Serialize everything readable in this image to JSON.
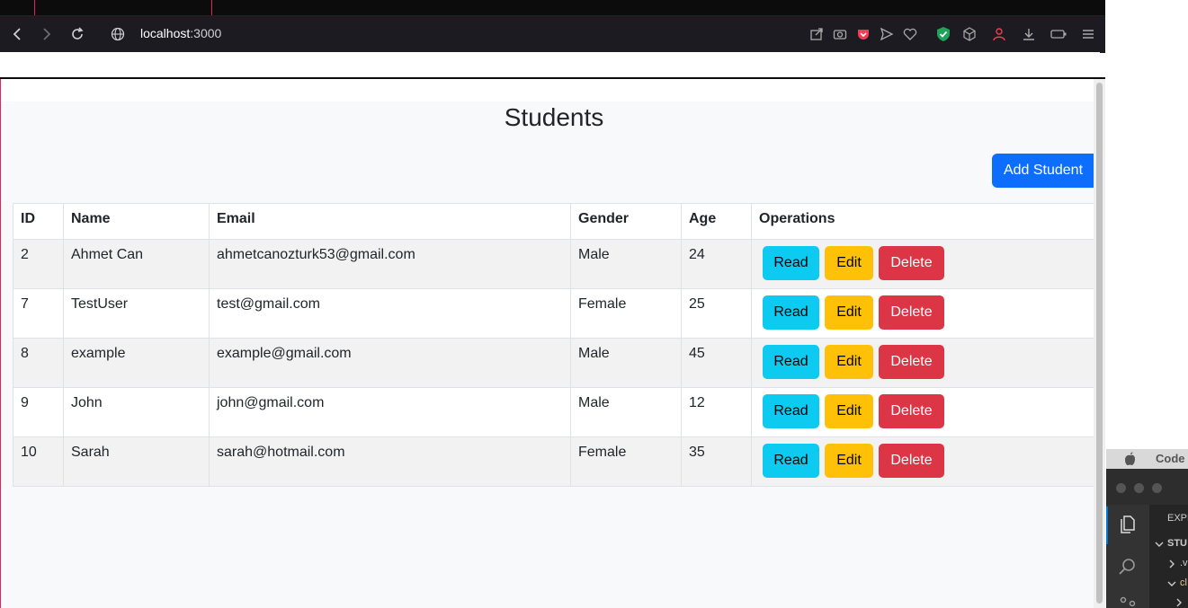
{
  "browser": {
    "url_host": "localhost",
    "url_port": ":3000"
  },
  "page": {
    "title": "Students",
    "add_button": "Add Student"
  },
  "table": {
    "headers": [
      "ID",
      "Name",
      "Email",
      "Gender",
      "Age",
      "Operations"
    ],
    "rows": [
      {
        "id": "2",
        "name": "Ahmet Can",
        "email": "ahmetcanozturk53@gmail.com",
        "gender": "Male",
        "age": "24"
      },
      {
        "id": "7",
        "name": "TestUser",
        "email": "test@gmail.com",
        "gender": "Female",
        "age": "25"
      },
      {
        "id": "8",
        "name": "example",
        "email": "example@gmail.com",
        "gender": "Male",
        "age": "45"
      },
      {
        "id": "9",
        "name": "John",
        "email": "john@gmail.com",
        "gender": "Male",
        "age": "12"
      },
      {
        "id": "10",
        "name": "Sarah",
        "email": "sarah@hotmail.com",
        "gender": "Female",
        "age": "35"
      }
    ],
    "ops": {
      "read": "Read",
      "edit": "Edit",
      "delete": "Delete"
    }
  },
  "vscode": {
    "app_name": "Code",
    "explorer_label": "EXPL",
    "folder_label": "STU",
    "item1": ".v",
    "item2": "cl"
  },
  "colors": {
    "primary": "#0d6efd",
    "info": "#0dcaf0",
    "warning": "#ffc107",
    "danger": "#dc3545"
  }
}
